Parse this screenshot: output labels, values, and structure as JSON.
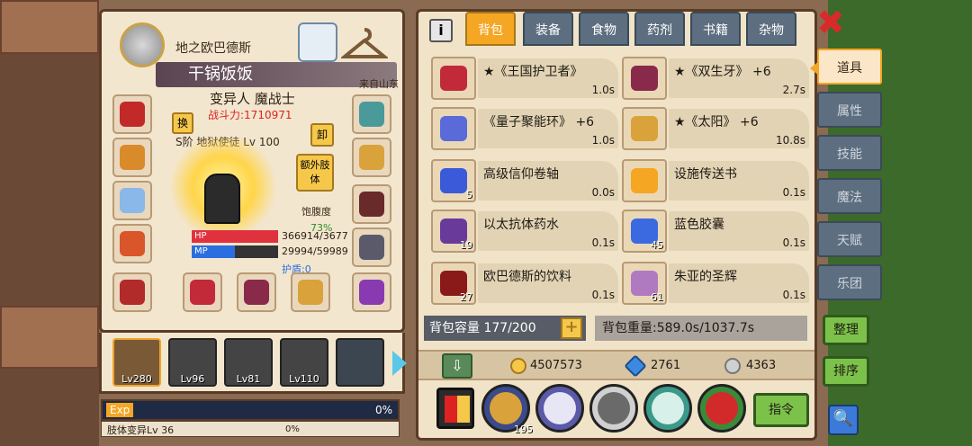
{
  "character": {
    "guild_name": "地之欧巴德斯",
    "gender_symbol": "♀",
    "name": "干锅饭饭",
    "origin": "来自山东",
    "class": "变异人 魔战士",
    "power": "战斗力:1710971",
    "swap_label": "换",
    "rank": "S阶 地狱使徒 Lv 100",
    "unequip_label": "卸",
    "extra_limb_label": "额外肢体",
    "satiety_label": "饱腹度",
    "satiety_value": "73%",
    "hp_label": "HP",
    "hp_text": "366914/3677",
    "hp_fraction": 0.998,
    "mp_label": "MP",
    "mp_text": "29994/59989",
    "mp_fraction": 0.5,
    "shield": "护盾:0"
  },
  "heroes": [
    {
      "level": "Lv280",
      "active": true
    },
    {
      "level": "Lv96",
      "active": false
    },
    {
      "level": "Lv81",
      "active": false
    },
    {
      "level": "Lv110",
      "active": false
    },
    {
      "level": "",
      "active": false
    }
  ],
  "exp": {
    "label": "Exp",
    "percent": "0%"
  },
  "mutation": {
    "label": "肢体变异Lv 36",
    "percent": "0%"
  },
  "tabs": [
    {
      "label": "背包",
      "active": true
    },
    {
      "label": "装备",
      "active": false
    },
    {
      "label": "食物",
      "active": false
    },
    {
      "label": "药剂",
      "active": false
    },
    {
      "label": "书籍",
      "active": false
    },
    {
      "label": "杂物",
      "active": false
    }
  ],
  "info_label": "i",
  "close_label": "✖",
  "inventory": [
    {
      "name": "★《王国护卫者》",
      "time": "1.0s",
      "count": "",
      "color": "#c22a3a"
    },
    {
      "name": "★《双生牙》 +6",
      "time": "2.7s",
      "count": "",
      "color": "#8a2a4a"
    },
    {
      "name": "《量子聚能环》 +6",
      "time": "1.0s",
      "count": "",
      "color": "#5a6ad9"
    },
    {
      "name": "★《太阳》 +6",
      "time": "10.8s",
      "count": "",
      "color": "#d9a23a"
    },
    {
      "name": "高级信仰卷轴",
      "time": "0.0s",
      "count": "5",
      "color": "#3b5ad9"
    },
    {
      "name": "设施传送书",
      "time": "0.1s",
      "count": "",
      "color": "#f5a623"
    },
    {
      "name": "以太抗体药水",
      "time": "0.1s",
      "count": "19",
      "color": "#6a3a9a"
    },
    {
      "name": "蓝色胶囊",
      "time": "0.1s",
      "count": "45",
      "color": "#3b6ae0"
    },
    {
      "name": "欧巴德斯的饮料",
      "time": "0.1s",
      "count": "27",
      "color": "#8a1a1a"
    },
    {
      "name": "朱亚的圣辉",
      "time": "0.1s",
      "count": "61",
      "color": "#b07ac0"
    }
  ],
  "capacity": "背包容量 177/200",
  "capacity_plus": "+",
  "weight": "背包重量:589.0s/1037.7s",
  "currency": {
    "gold": "4507573",
    "gems": "2761",
    "silver": "4363"
  },
  "action_badge": "195",
  "command_label": "指令",
  "side_nav": [
    {
      "label": "道具",
      "active": true
    },
    {
      "label": "属性",
      "active": false
    },
    {
      "label": "技能",
      "active": false
    },
    {
      "label": "魔法",
      "active": false
    },
    {
      "label": "天赋",
      "active": false
    },
    {
      "label": "乐团",
      "active": false
    }
  ],
  "organize_label": "整理",
  "sort_label": "排序",
  "search_label": "🔍",
  "colors": {
    "accent": "#f5a623",
    "tab": "#5c6e80",
    "green": "#7cc24a",
    "hp": "#e0313e",
    "mp": "#2b6ee0"
  }
}
